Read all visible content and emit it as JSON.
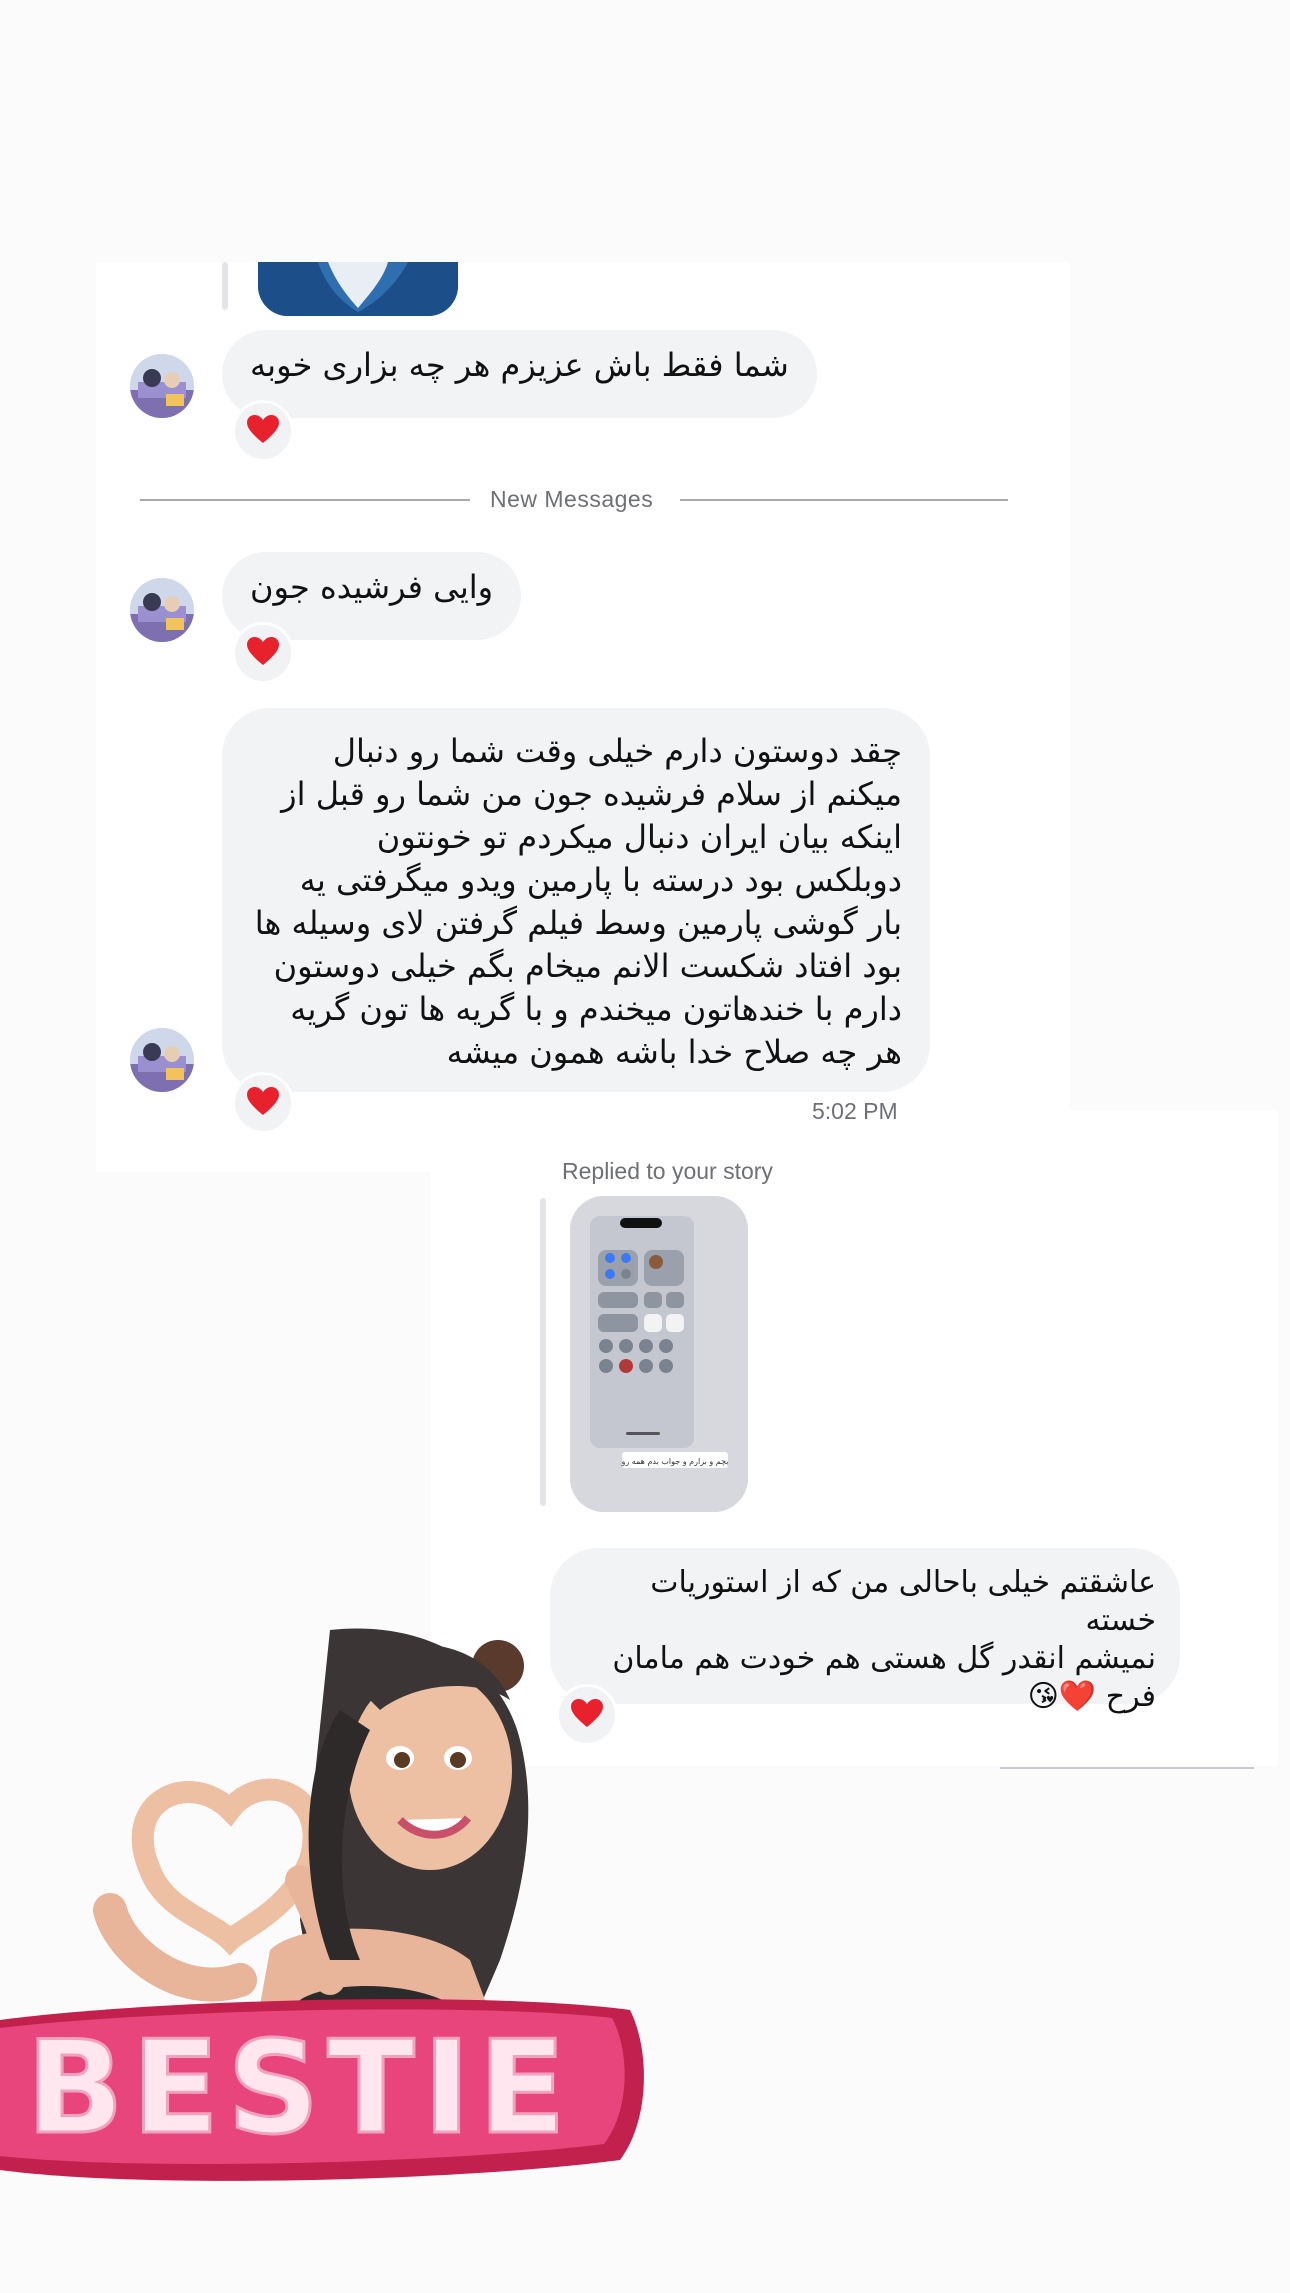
{
  "thread": {
    "divider_label": "New Messages",
    "messages": [
      {
        "text": "شما فقط باش عزیزم هر چه بزاری خوبه",
        "reaction": "❤️"
      },
      {
        "text": "وایی فرشیده جون",
        "reaction": "❤️"
      },
      {
        "lines": [
          "چقد دوستون دارم خیلی وقت شما رو دنبال",
          "میکنم از سلام فرشیده جون من شما رو قبل از",
          "اینکه بیان ایران دنبال میکردم تو خونتون",
          "دوبلکس بود درسته با پارمین ویدو میگرفتی یه",
          "بار گوشی پارمین وسط فیلم گرفتن لای وسیله ها",
          "بود افتاد شکست الانم میخام بگم خیلی دوستون",
          "دارم با خندهاتون میخندم و با گریه ها تون گریه",
          "هر چه صلاح خدا باشه همون میشه"
        ],
        "reaction": "❤️",
        "timestamp": "5:02 PM"
      }
    ],
    "story_reply": {
      "label": "Replied to your story",
      "story_caption": "بچم و بزارم و جواب بدم همه رو",
      "lines": [
        "عاشقتم خیلی باحالی من که از استوریات خسته",
        "نمیشم انقدر گل هستی هم خودت هم مامان",
        "فرح ❤️😘"
      ],
      "reaction": "❤️"
    },
    "sticker": {
      "text": "BESTIE"
    }
  },
  "colors": {
    "bubble": "#f2f3f5",
    "heart": "#e8222d",
    "divider": "#a7a9ad",
    "sticker_pink": "#e8457c"
  }
}
